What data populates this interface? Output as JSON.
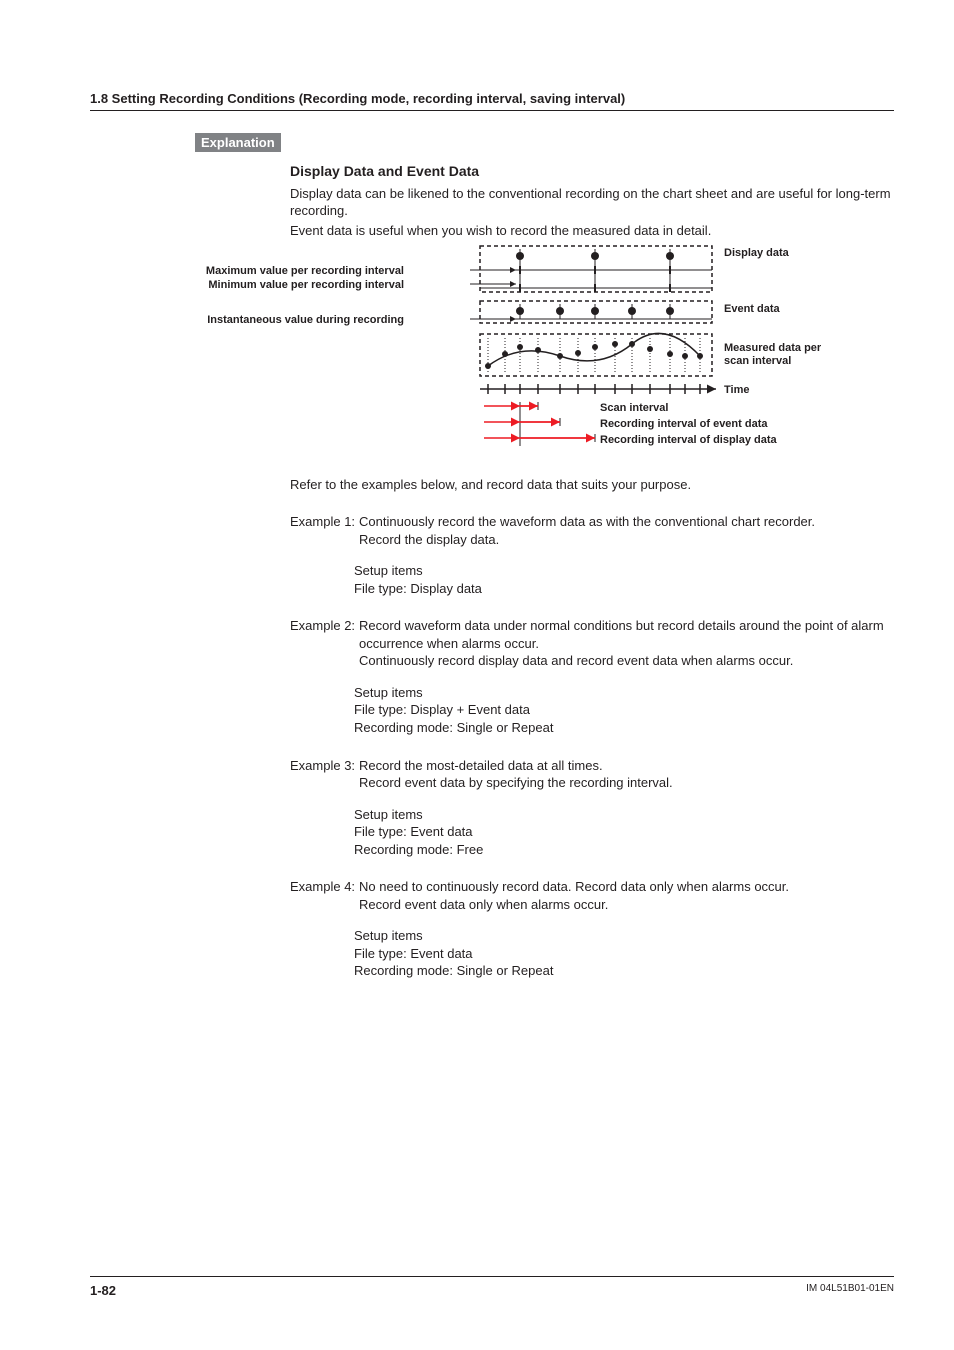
{
  "header": "1.8  Setting Recording Conditions (Recording mode, recording interval, saving interval)",
  "sectionTag": "Explanation",
  "subHeading": "Display Data and Event Data",
  "intro1": "Display data can be likened to the conventional recording on the chart sheet and are useful for long-term recording.",
  "intro2": "Event data is useful when you wish to record the measured data in detail.",
  "diagram": {
    "maxLabel": "Maximum value per recording interval",
    "minLabel": "Minimum value per recording interval",
    "instLabel": "Instantaneous value during recording",
    "displayData": "Display data",
    "eventData": "Event data",
    "measured": "Measured data per scan interval",
    "time": "Time",
    "scanInt": "Scan interval",
    "recEvt": "Recording interval of event data",
    "recDisp": "Recording interval of display data"
  },
  "refer": "Refer to the examples below, and record data that suits your purpose.",
  "ex1": {
    "label": "Example 1:",
    "l1": "Continuously record the waveform data as with the conventional chart recorder.",
    "l2": "Record the display data.",
    "s1": "Setup items",
    "s2": "File type: Display data"
  },
  "ex2": {
    "label": "Example 2:",
    "l1": "Record waveform data under normal conditions but record details around the point of alarm occurrence when alarms occur.",
    "l2": "Continuously record display data and record event data when alarms occur.",
    "s1": "Setup items",
    "s2": "File type: Display + Event data",
    "s3": "Recording mode: Single or Repeat"
  },
  "ex3": {
    "label": "Example 3:",
    "l1": "Record the most-detailed data at all times.",
    "l2": "Record event data by specifying the recording interval.",
    "s1": "Setup items",
    "s2": "File type: Event data",
    "s3": "Recording mode: Free"
  },
  "ex4": {
    "label": "Example 4:",
    "l1": "No need to continuously record data. Record data only when alarms occur.",
    "l2": "Record event data only when alarms occur.",
    "s1": "Setup items",
    "s2": "File type: Event data",
    "s3": "Recording mode: Single or Repeat"
  },
  "footer": {
    "page": "1-82",
    "doc": "IM 04L51B01-01EN"
  }
}
